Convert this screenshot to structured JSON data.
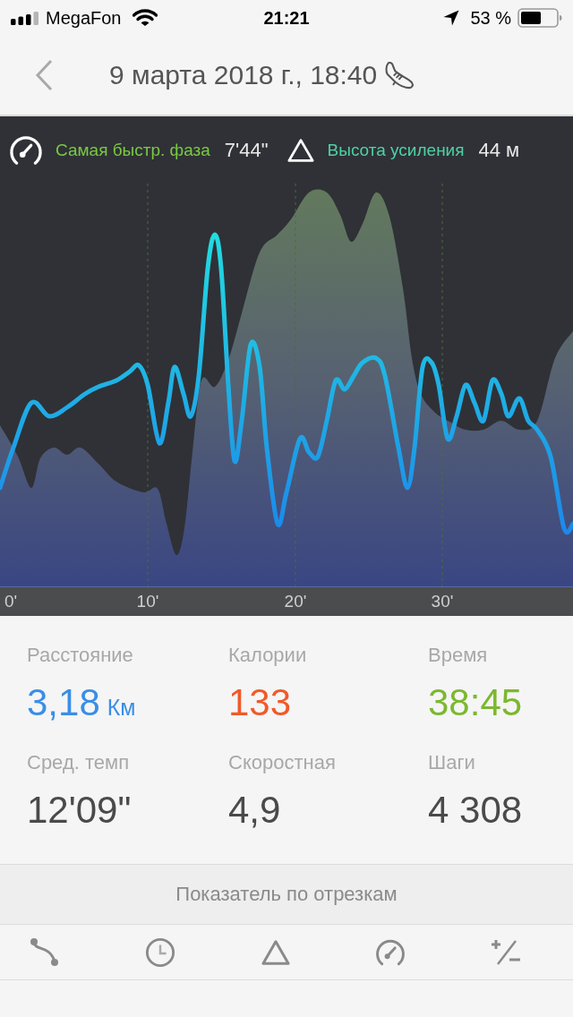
{
  "status_bar": {
    "carrier": "MegaFon",
    "time": "21:21",
    "battery": "53 %"
  },
  "header": {
    "title": "9 марта 2018 г., 18:40"
  },
  "highlights": [
    {
      "kind": "pace",
      "label": "Самая быстр. фаза",
      "value": "7'44\"",
      "color": "#7ac943"
    },
    {
      "kind": "elevation",
      "label": "Высота усиления",
      "value": "44 м",
      "color": "#4fd1a5"
    }
  ],
  "chart": {
    "x_labels": [
      "0'",
      "10'",
      "20'",
      "30'"
    ]
  },
  "stats": [
    {
      "label": "Расстояние",
      "value": "3,18",
      "unit": "Км",
      "color": "#3a8ee6"
    },
    {
      "label": "Калории",
      "value": "133",
      "color": "#f05a28"
    },
    {
      "label": "Время",
      "value": "38:45",
      "color": "#7cb82f"
    },
    {
      "label": "Сред. темп",
      "value": "12'09\""
    },
    {
      "label": "Скоростная",
      "value": "4,9"
    },
    {
      "label": "Шаги",
      "value": "4 308"
    }
  ],
  "segments": {
    "title": "Показатель по отрезкам",
    "tabs": [
      {
        "kind": "route"
      },
      {
        "kind": "time"
      },
      {
        "kind": "elevation"
      },
      {
        "kind": "speed"
      },
      {
        "kind": "plusminus"
      }
    ]
  }
}
